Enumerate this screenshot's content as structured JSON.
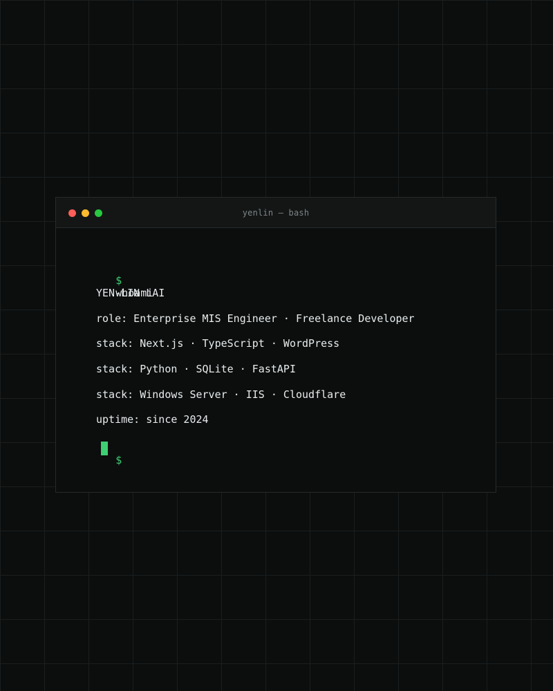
{
  "window": {
    "title": "yenlin — bash",
    "controls": {
      "close_color": "#ff5f57",
      "minimize_color": "#febc2e",
      "maximize_color": "#28c840"
    }
  },
  "terminal": {
    "prompt_symbol": "$",
    "command": "whoami",
    "output": {
      "name": "YEN-LIN LAI",
      "role": "role: Enterprise MIS Engineer · Freelance Developer",
      "stack_1": "stack: Next.js · TypeScript · WordPress",
      "stack_2": "stack: Python · SQLite · FastAPI",
      "stack_3": "stack: Windows Server · IIS · Cloudflare",
      "uptime": "uptime: since 2024"
    },
    "accent_color": "#3ecf72"
  }
}
